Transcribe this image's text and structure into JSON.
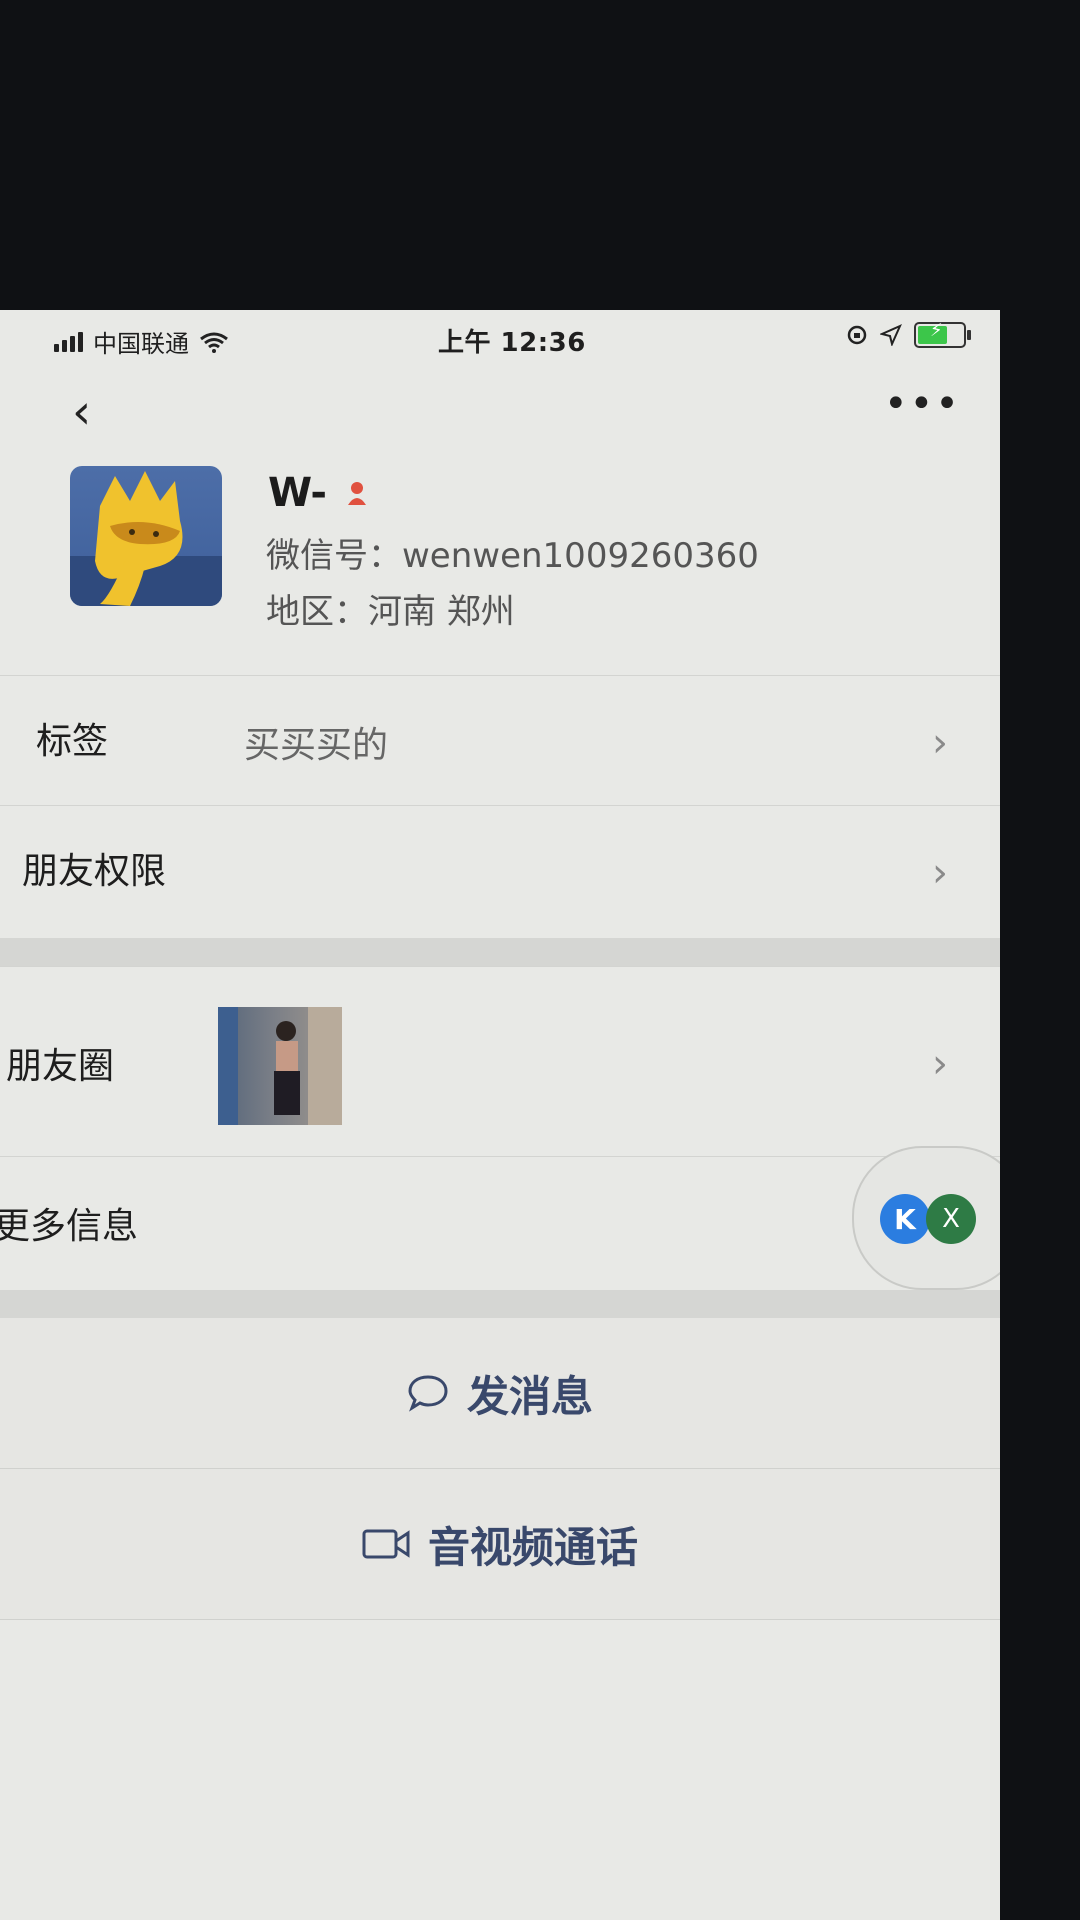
{
  "status_bar": {
    "carrier": "中国联通",
    "time": "上午 12:36"
  },
  "nav": {
    "back_icon": "chevron-left-icon",
    "more_label": "•••"
  },
  "profile": {
    "name": "W-",
    "gender_icon": "female-icon",
    "wechat_id_label": "微信号：",
    "wechat_id": "wenwen1009260360",
    "region_label": "地区：",
    "region": "河南 郑州"
  },
  "rows": {
    "tags_label": "标签",
    "tags_value": "买买买的",
    "permissions_label": "朋友权限",
    "moments_label": "朋友圈",
    "more_info_label": "更多信息"
  },
  "floating": {
    "k_label": "K",
    "x_label": "X"
  },
  "actions": {
    "message_label": "发消息",
    "call_label": "音视频通话"
  },
  "colors": {
    "accent": "#39486b",
    "battery": "#3cc64a",
    "gender": "#e0513f"
  }
}
